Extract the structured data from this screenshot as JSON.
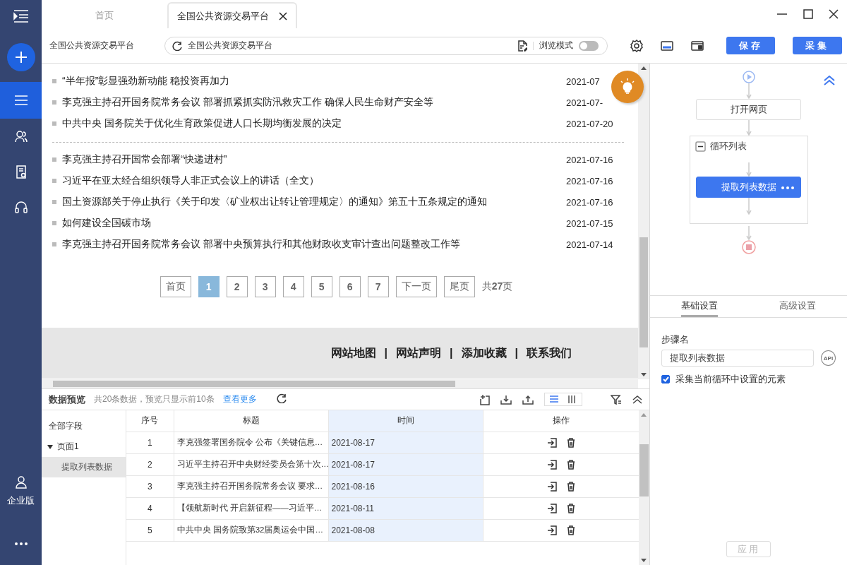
{
  "sidebar": {
    "nav_items": [
      {
        "selected": true
      },
      {
        "selected": false
      },
      {
        "selected": false
      },
      {
        "selected": false
      }
    ],
    "account_label": "企业版"
  },
  "tabs": [
    {
      "label": "首页",
      "selected": false
    },
    {
      "label": "全国公共资源交易平台",
      "selected": true
    }
  ],
  "toolbar": {
    "page_title": "全国公共资源交易平台",
    "address": "全国公共资源交易平台",
    "browse_mode": {
      "label": "浏览模式",
      "on": false
    },
    "buttons": [
      "保存",
      "采集"
    ]
  },
  "webpage": {
    "news_groups": [
      [
        {
          "title": "“半年报”彰显强劲新动能 稳投资再加力",
          "date": "2021-07"
        },
        {
          "title": "李克强主持召开国务院常务会议 部署抓紧抓实防汛救灾工作 确保人民生命财产安全等",
          "date": "2021-07-"
        },
        {
          "title": "中共中央 国务院关于优化生育政策促进人口长期均衡发展的决定",
          "date": "2021-07-20"
        }
      ],
      [
        {
          "title": "李克强主持召开国常会部署“快递进村”",
          "date": "2021-07-16"
        },
        {
          "title": "习近平在亚太经合组织领导人非正式会议上的讲话（全文）",
          "date": "2021-07-16"
        },
        {
          "title": "国土资源部关于停止执行《关于印发〈矿业权出让转让管理规定〉的通知》第五十五条规定的通知",
          "date": "2021-07-16"
        },
        {
          "title": "如何建设全国碳市场",
          "date": "2021-07-15"
        },
        {
          "title": "李克强主持召开国务院常务会议 部署中央预算执行和其他财政收支审计查出问题整改工作等",
          "date": "2021-07-14"
        }
      ]
    ],
    "pagination": {
      "first": "首页",
      "pages": [
        {
          "label": "1",
          "selected": true
        },
        {
          "label": "2",
          "selected": false
        },
        {
          "label": "3",
          "selected": false
        },
        {
          "label": "4",
          "selected": false
        },
        {
          "label": "5",
          "selected": false
        },
        {
          "label": "6",
          "selected": false
        },
        {
          "label": "7",
          "selected": false
        }
      ],
      "next": "下一页",
      "last": "尾页",
      "total": "共**27**页"
    },
    "footer": {
      "links": [
        "网站地图",
        "网站声明",
        "添加收藏",
        "联系我们"
      ],
      "separator": "|"
    }
  },
  "workflow": {
    "steps": [
      {
        "kind": "action",
        "label": "打开网页",
        "selected": false
      },
      {
        "kind": "loop",
        "label": "循环列表",
        "expanded": true,
        "children": [
          {
            "kind": "action",
            "label": "提取列表数据",
            "selected": true
          }
        ]
      }
    ]
  },
  "settings": {
    "tabs": [
      {
        "label": "基础设置",
        "selected": true
      },
      {
        "label": "高级设置",
        "selected": false
      }
    ],
    "step_name_label": "步骤名",
    "step_name": "提取列表数据",
    "api_badge": "API",
    "collect_in_loop": {
      "label": "采集当前循环中设置的元素",
      "checked": true
    },
    "apply": {
      "label": "应用",
      "disabled": true
    }
  },
  "preview": {
    "title": "数据预览",
    "summary": "共20条数据，预览只显示前10条",
    "more_link": "查看更多",
    "view_modes": [
      {
        "selected": true
      },
      {
        "selected": false
      }
    ],
    "fields": {
      "label": "全部字段",
      "pages": [
        {
          "label": "页面1",
          "expanded": true,
          "children": [
            {
              "label": "提取列表数据",
              "selected": true
            }
          ]
        }
      ]
    },
    "table": {
      "columns": [
        {
          "label": "序号",
          "selected": false
        },
        {
          "label": "标题",
          "selected": false
        },
        {
          "label": "时间",
          "selected": true
        },
        {
          "label": "操作",
          "selected": false
        }
      ],
      "rows": [
        [
          "1",
          "李克强签署国务院令 公布《关键信息…",
          "2021-08-17"
        ],
        [
          "2",
          "习近平主持召开中央财经委员会第十次…",
          "2021-08-17"
        ],
        [
          "3",
          "李克强主持召开国务院常务会议 要求…",
          "2021-08-16"
        ],
        [
          "4",
          "【领航新时代 开启新征程——习近平…",
          "2021-08-11"
        ],
        [
          "5",
          "中共中央 国务院致第32届奥运会中国…",
          "2021-08-08"
        ]
      ]
    }
  }
}
